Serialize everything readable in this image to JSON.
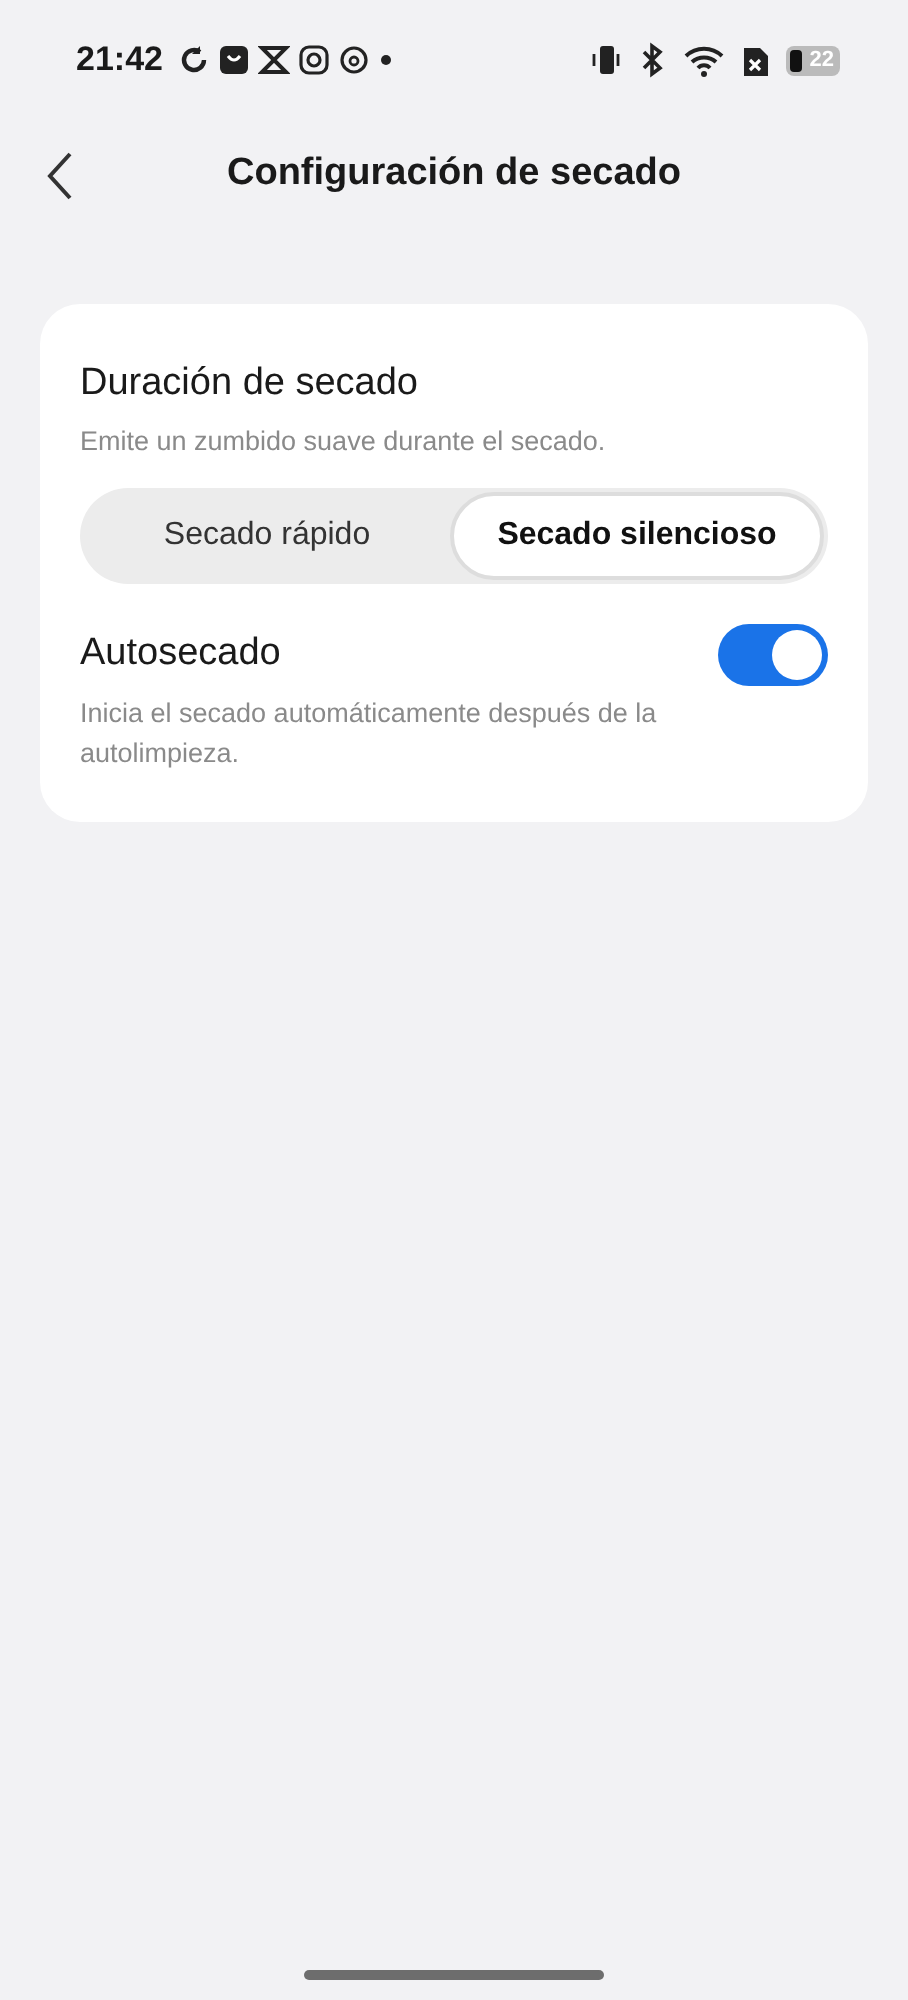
{
  "status_bar": {
    "time": "21:42",
    "battery": "22"
  },
  "header": {
    "title": "Configuración de secado"
  },
  "settings": [
    {
      "kind": "segmented",
      "title": "Duración de secado",
      "description": "Emite un zumbido suave durante el secado.",
      "options": [
        {
          "label": "Secado rápido",
          "selected": false
        },
        {
          "label": "Secado silencioso",
          "selected": true
        }
      ]
    },
    {
      "kind": "toggle",
      "title": "Autosecado",
      "description": "Inicia el secado automáticamente después de la autolimpieza.",
      "on": true
    }
  ]
}
